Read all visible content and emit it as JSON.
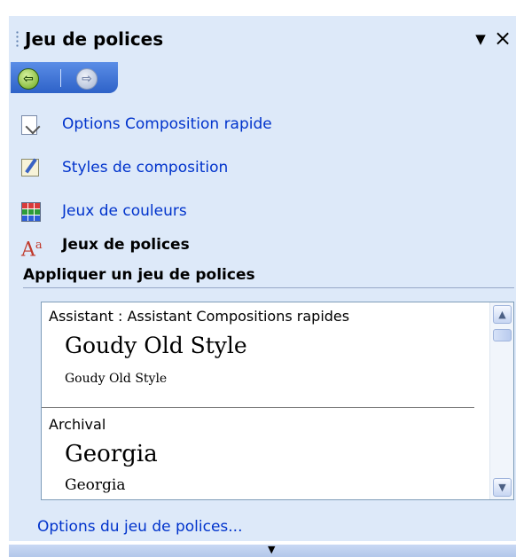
{
  "pane": {
    "title": "Jeu de polices",
    "dropdown_glyph": "▼",
    "close_glyph": "×"
  },
  "nav": {
    "back_glyph": "⇦",
    "forward_glyph": "⇨"
  },
  "menu": {
    "items": [
      {
        "label": "Options Composition rapide",
        "icon": "layout-options-icon"
      },
      {
        "label": "Styles de composition",
        "icon": "publication-designs-icon"
      },
      {
        "label": "Jeux de couleurs",
        "icon": "color-schemes-icon"
      },
      {
        "label": "Jeux de polices",
        "icon": "font-schemes-icon",
        "active": true
      }
    ],
    "font_icon_text": "A",
    "font_icon_sup": "a"
  },
  "section": {
    "title": "Appliquer un jeu de polices"
  },
  "font_schemes": [
    {
      "name": "Assistant : Assistant Compositions rapides",
      "heading_font": "Goudy Old Style",
      "body_font": "Goudy Old Style"
    },
    {
      "name": "Archival",
      "heading_font": "Georgia",
      "body_font": "Georgia"
    }
  ],
  "scrollbar": {
    "up_glyph": "▲",
    "down_glyph": "▼"
  },
  "footer": {
    "link": "Options du jeu de polices..."
  },
  "bottom": {
    "more_glyph": "▼"
  },
  "colors": {
    "pane_bg": "#dde9f9",
    "link": "#0033cc",
    "nav_bar": "#3a6fd4"
  }
}
